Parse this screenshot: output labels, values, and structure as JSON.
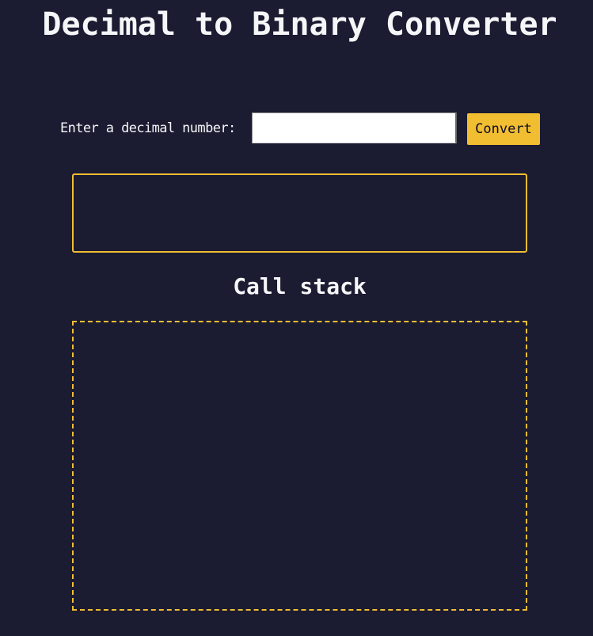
{
  "page": {
    "title": "Decimal to Binary Converter"
  },
  "form": {
    "label": "Enter a decimal number:",
    "input_value": "",
    "convert_label": "Convert"
  },
  "result": {
    "text": ""
  },
  "call_stack": {
    "heading": "Call stack",
    "frames": []
  },
  "colors": {
    "background": "#1b1b32",
    "accent": "#f1be32",
    "text": "#f5f6f7"
  }
}
